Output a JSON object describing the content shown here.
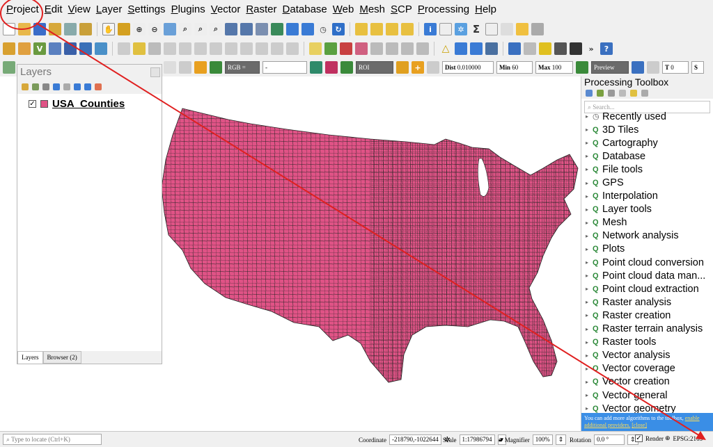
{
  "menubar": {
    "items": [
      "Project",
      "Edit",
      "View",
      "Layer",
      "Settings",
      "Plugins",
      "Vector",
      "Raster",
      "Database",
      "Web",
      "Mesh",
      "SCP",
      "Processing",
      "Help"
    ]
  },
  "toolbar3": {
    "rgb": "RGB =",
    "roi": "ROI",
    "dist_label": "Dist",
    "dist_value": "0.010000",
    "min_label": "Min",
    "min_value": "60",
    "max_label": "Max",
    "max_value": "100",
    "preview": "Preview",
    "t_label": "T",
    "t_value": "0",
    "s_label": "S"
  },
  "layers_panel": {
    "title": "Layers",
    "layer_name": "USA_Counties",
    "layer_color": "#e05386",
    "tabs": [
      "Layers",
      "Browser (2)"
    ]
  },
  "processing_toolbox": {
    "title": "Processing Toolbox",
    "search_placeholder": "Search...",
    "items": [
      "Recently used",
      "3D Tiles",
      "Cartography",
      "Database",
      "File tools",
      "GPS",
      "Interpolation",
      "Layer tools",
      "Mesh",
      "Network analysis",
      "Plots",
      "Point cloud conversion",
      "Point cloud data man...",
      "Point cloud extraction",
      "Raster analysis",
      "Raster creation",
      "Raster terrain analysis",
      "Raster tools",
      "Vector analysis",
      "Vector coverage",
      "Vector creation",
      "Vector general",
      "Vector geometry"
    ],
    "footer_text": "You can add more algorithms to the toolbox,",
    "footer_link1": "enable",
    "footer_link2": "additional providers.",
    "footer_close": "[close]"
  },
  "statusbar": {
    "locate_placeholder": "Type to locate (Ctrl+K)",
    "coordinate_label": "Coordinate",
    "coordinate_value": "-218790,-1022644",
    "scale_label": "Scale",
    "scale_value": "1:17986794",
    "magnifier_label": "Magnifier",
    "magnifier_value": "100%",
    "rotation_label": "Rotation",
    "rotation_value": "0.0 °",
    "render_label": "Render",
    "crs": "EPSG:2163"
  },
  "colors": {
    "counties_fill": "#e05386",
    "annotation": "#e02020",
    "footer_bg": "#3a8ee6"
  }
}
